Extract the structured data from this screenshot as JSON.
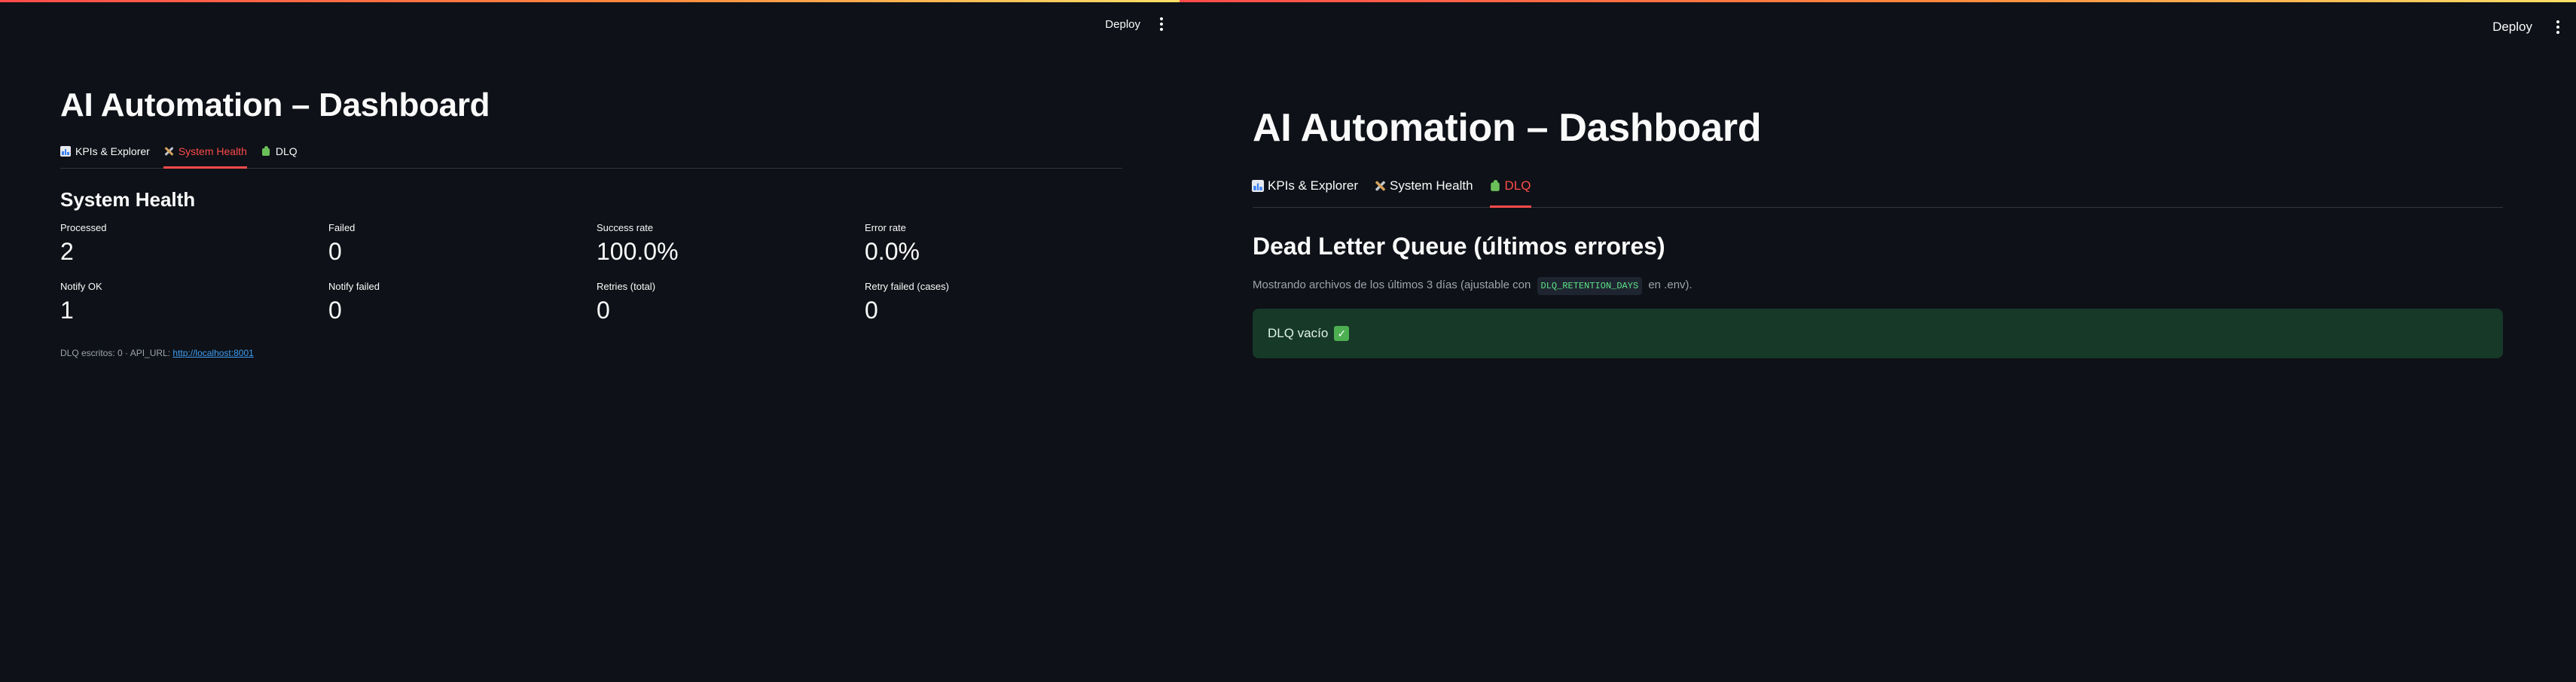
{
  "colors": {
    "background": "#0e1117",
    "accent": "#ff4b4b",
    "link": "#3d9df3",
    "success_bg": "#173928",
    "code_text": "#5ce488"
  },
  "left_pane": {
    "toolbar": {
      "deploy_label": "Deploy",
      "menu_icon": "kebab-menu-icon"
    },
    "title": "AI Automation – Dashboard",
    "tabs": [
      {
        "label": "KPIs & Explorer",
        "icon": "bar-chart-icon",
        "active": false
      },
      {
        "label": "System Health",
        "icon": "tools-icon",
        "active": true
      },
      {
        "label": "DLQ",
        "icon": "puzzle-icon",
        "active": false
      }
    ],
    "section_heading": "System Health",
    "metrics": [
      {
        "label": "Processed",
        "value": "2"
      },
      {
        "label": "Failed",
        "value": "0"
      },
      {
        "label": "Success rate",
        "value": "100.0%"
      },
      {
        "label": "Error rate",
        "value": "0.0%"
      },
      {
        "label": "Notify OK",
        "value": "1"
      },
      {
        "label": "Notify failed",
        "value": "0"
      },
      {
        "label": "Retries (total)",
        "value": "0"
      },
      {
        "label": "Retry failed (cases)",
        "value": "0"
      }
    ],
    "footer": {
      "prefix": "DLQ escritos: 0 · API_URL: ",
      "link": "http://localhost:8001"
    }
  },
  "right_pane": {
    "toolbar": {
      "deploy_label": "Deploy",
      "menu_icon": "kebab-menu-icon"
    },
    "title": "AI Automation – Dashboard",
    "tabs": [
      {
        "label": "KPIs & Explorer",
        "icon": "bar-chart-icon",
        "active": false
      },
      {
        "label": "System Health",
        "icon": "tools-icon",
        "active": false
      },
      {
        "label": "DLQ",
        "icon": "puzzle-icon",
        "active": true
      }
    ],
    "section_heading": "Dead Letter Queue (últimos errores)",
    "caption": {
      "prefix": "Mostrando archivos de los últimos 3 días (ajustable con",
      "code": "DLQ_RETENTION_DAYS",
      "suffix": "en .env)."
    },
    "alert": {
      "text": "DLQ vacío",
      "icon": "check-mark-icon"
    }
  }
}
